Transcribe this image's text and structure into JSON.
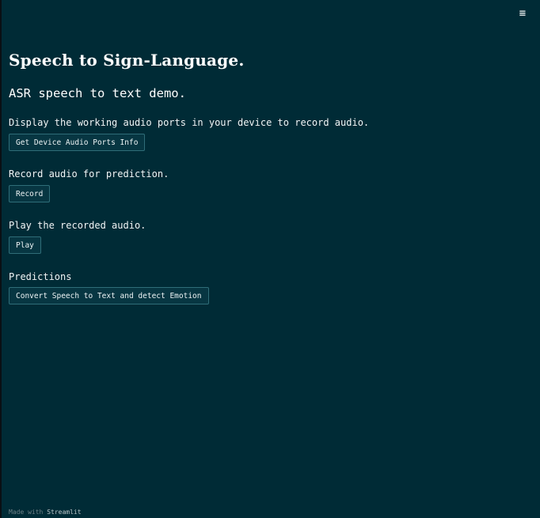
{
  "header": {
    "menu_icon": "hamburger-menu-icon",
    "menu_glyph": "≡"
  },
  "main": {
    "title": "Speech to Sign-Language.",
    "subtitle": "ASR speech to text demo.",
    "sections": [
      {
        "text": "Display the working audio ports in your device to record audio.",
        "button_label": "Get Device Audio Ports Info"
      },
      {
        "text": "Record audio for prediction.",
        "button_label": "Record"
      },
      {
        "text": "Play the recorded audio.",
        "button_label": "Play"
      },
      {
        "text": "Predictions",
        "button_label": "Convert Speech to Text and detect Emotion"
      }
    ]
  },
  "footer": {
    "prefix": "Made with",
    "brand": "Streamlit"
  },
  "colors": {
    "background": "#002b36",
    "button_background": "#073642",
    "button_border": "#2f6d78",
    "text": "#ffffff"
  }
}
